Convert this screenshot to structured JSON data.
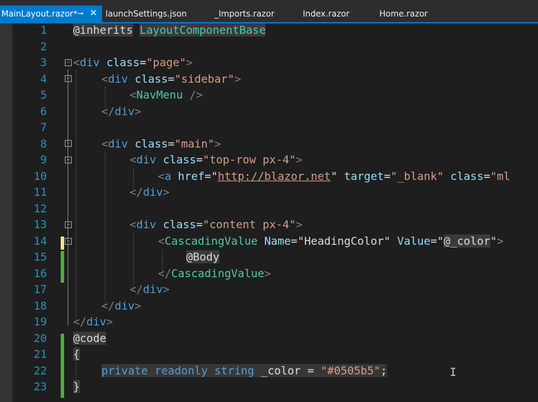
{
  "tabs": [
    {
      "label": "MainLayout.razor*",
      "active": true,
      "pin": "⊸",
      "close": "✕"
    },
    {
      "label": "launchSettings.json"
    },
    {
      "label": "_Imports.razor"
    },
    {
      "label": "Index.razor"
    },
    {
      "label": "Home.razor"
    }
  ],
  "lines": [
    "1",
    "2",
    "3",
    "4",
    "5",
    "6",
    "7",
    "8",
    "9",
    "10",
    "11",
    "12",
    "13",
    "14",
    "15",
    "16",
    "17",
    "18",
    "19",
    "20",
    "21",
    "22",
    "23"
  ],
  "code": {
    "l1_at": "@inherits",
    "l1_type": "LayoutComponentBase",
    "l3_div": "div",
    "l3_attr": "class",
    "l3_val": "\"page\"",
    "l4_div": "div",
    "l4_attr": "class",
    "l4_val": "\"sidebar\"",
    "l5_comp": "NavMenu",
    "l6_div": "div",
    "l8_div": "div",
    "l8_attr": "class",
    "l8_val": "\"main\"",
    "l9_div": "div",
    "l9_attr": "class",
    "l9_val": "\"top-row px-4\"",
    "l10_a": "a",
    "l10_href": "href",
    "l10_url": "http://blazor.net",
    "l10_target": "target",
    "l10_targetval": "\"_blank\"",
    "l10_class": "class",
    "l10_rest": "\"ml",
    "l11_div": "div",
    "l13_div": "div",
    "l13_attr": "class",
    "l13_val": "\"content px-4\"",
    "l14_comp": "CascadingValue",
    "l14_name": "Name",
    "l14_nameval": "\"HeadingColor\"",
    "l14_value": "Value",
    "l14_valueval_open": "\"",
    "l14_at": "@",
    "l14_var": "_color",
    "l14_valueval_close": "\"",
    "l15_body": "@Body",
    "l16_comp": "CascadingValue",
    "l17_div": "div",
    "l18_div": "div",
    "l19_div": "div",
    "l20_code": "@code",
    "l21_brace": "{",
    "l22_kw": "private readonly string",
    "l22_var": "_color",
    "l22_eq": "=",
    "l22_str": "\"#0505b5\"",
    "l22_semi": ";",
    "l23_brace": "}"
  }
}
